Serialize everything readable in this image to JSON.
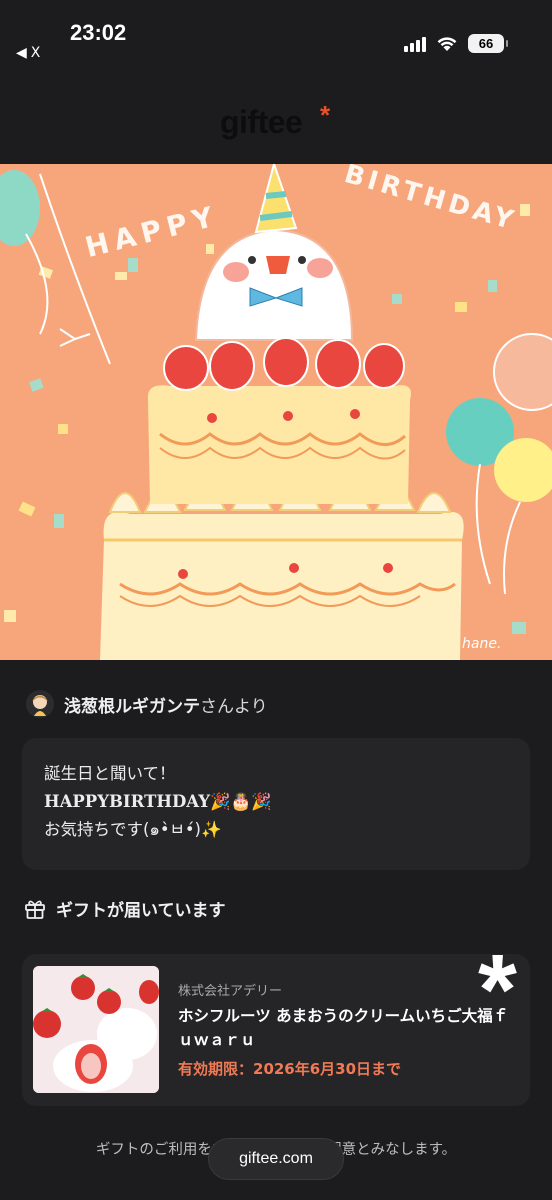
{
  "status_bar": {
    "time": "23:02",
    "back_label": "X",
    "battery": "66"
  },
  "header": {
    "logo": "giftee",
    "logo_mark": "*"
  },
  "card": {
    "happy_text": "HAPPY",
    "birthday_text": "BIRTHDAY",
    "signature": "hane."
  },
  "sender": {
    "name": "浅葱根ルギガンテ",
    "suffix": "さんより"
  },
  "message": {
    "line1": "誕生日と聞いて！",
    "line2": "HAPPYBIRTHDAY🎉🎂🎉",
    "line3": "お気持ちです(๑•̀ㅂ•́)✨"
  },
  "gift_section": {
    "heading": "ギフトが届いています"
  },
  "gift": {
    "vendor": "株式会社アデリー",
    "name": "ホシフルーツ あまおうのクリームいちご大福ｆｕｗａｒｕ",
    "expiry": "有効期限：2026年6月30日まで",
    "overlay_mark": "*"
  },
  "footer": {
    "note": "ギフトのご利用をもって利用規約に同意とみなします。",
    "url": "giftee.com"
  },
  "colors": {
    "card_background": "#f6a67a",
    "accent": "#f07a55"
  }
}
